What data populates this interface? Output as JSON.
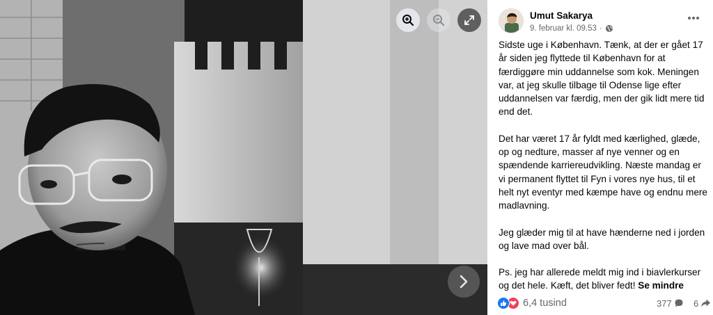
{
  "viewer": {
    "zoom_in_icon": "zoom-in-icon",
    "zoom_out_icon": "zoom-out-icon",
    "fullscreen_icon": "expand-icon",
    "next_icon": "chevron-right-icon"
  },
  "post": {
    "author": "Umut Sakarya",
    "timestamp": "9. februar kl. 09.53",
    "separator": "·",
    "privacy_icon": "globe-icon",
    "paragraphs": [
      "Sidste uge i København. Tænk, at der er gået 17 år siden jeg flyttede til København for at færdiggøre min uddannelse som kok. Meningen var, at jeg skulle tilbage til Odense lige efter uddannelsen var færdig, men der gik lidt mere tid end det.",
      "Det har været 17 år fyldt med kærlighed, glæde, op og nedture, masser af nye venner og en spændende karriereudvikling. Næste mandag er vi permanent flyttet til Fyn i vores nye hus, til et helt nyt eventyr med kæmpe have og endnu mere madlavning.",
      "Jeg glæder mig til at have hænderne ned i jorden og lave mad over bål.",
      "Ps. jeg har allerede meldt mig ind i biavlerkurser og det hele. Kæft, det bliver fedt!"
    ],
    "see_more": "Se mindre",
    "reactions_count": "6,4 tusind",
    "comments_count": "377",
    "shares_count": "6",
    "colors": {
      "like": "#1877f2",
      "love": "#f33e58",
      "secondary_text": "#65676b"
    }
  }
}
